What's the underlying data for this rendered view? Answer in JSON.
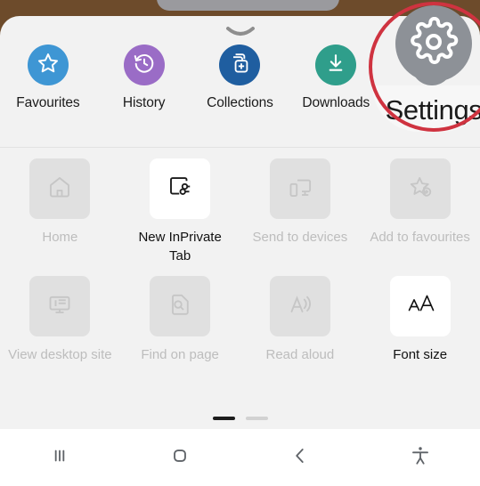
{
  "window": {
    "app": "Microsoft Edge Android browser menu",
    "sheet_background": "#f2f2f2",
    "page_background": "#6d4b2b"
  },
  "drag_handle": {
    "name": "collapse-handle"
  },
  "top_row": {
    "items": [
      {
        "label": "Favourites",
        "icon": "star-icon",
        "color": "#3e96d4",
        "enabled": true
      },
      {
        "label": "History",
        "icon": "history-clock-icon",
        "color": "#9a6cc6",
        "enabled": true
      },
      {
        "label": "Collections",
        "icon": "collections-add-icon",
        "color": "#1f5ea0",
        "enabled": true
      },
      {
        "label": "Downloads",
        "icon": "download-arrow-icon",
        "color": "#2f9e8b",
        "enabled": true
      },
      {
        "label": "Settings",
        "icon": "gear-icon",
        "color": "#8d9197",
        "enabled": true
      }
    ]
  },
  "grid": {
    "items": [
      {
        "label": "Home",
        "icon": "home-icon",
        "enabled": false
      },
      {
        "label": "New InPrivate Tab",
        "icon": "inprivate-icon",
        "enabled": true
      },
      {
        "label": "Send to devices",
        "icon": "send-to-devices-icon",
        "enabled": false
      },
      {
        "label": "Add to favourites",
        "icon": "star-add-icon",
        "enabled": false
      },
      {
        "label": "View desktop site",
        "icon": "desktop-monitor-icon",
        "enabled": false
      },
      {
        "label": "Find on page",
        "icon": "find-page-icon",
        "enabled": false
      },
      {
        "label": "Read aloud",
        "icon": "read-aloud-icon",
        "enabled": false
      },
      {
        "label": "Font size",
        "icon": "font-size-icon",
        "enabled": true
      }
    ]
  },
  "pagination": {
    "pages": [
      {
        "active": true
      },
      {
        "active": false
      }
    ]
  },
  "navbar": {
    "buttons": [
      {
        "name": "recents-icon"
      },
      {
        "name": "home-circle-icon"
      },
      {
        "name": "back-chevron-icon"
      },
      {
        "name": "accessibility-icon"
      }
    ]
  },
  "annotation": {
    "target": "Settings",
    "circle_color": "#cf3340",
    "zoom_label": "Settings"
  }
}
